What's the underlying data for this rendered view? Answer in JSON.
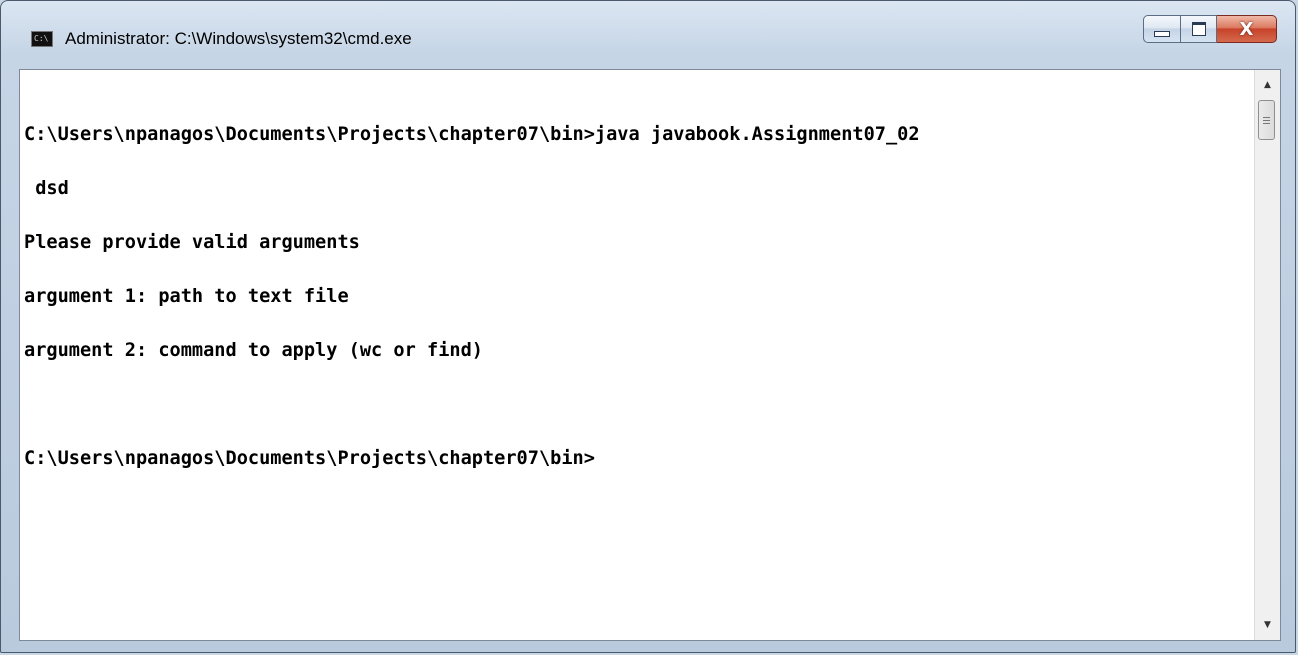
{
  "window": {
    "title": "Administrator: C:\\Windows\\system32\\cmd.exe",
    "icon": "console-app-icon",
    "icon_text": "C:\\",
    "controls": {
      "minimize": "minimize-icon",
      "maximize": "maximize-icon",
      "close": "close-icon",
      "close_glyph": "X"
    }
  },
  "console": {
    "lines": [
      "C:\\Users\\npanagos\\Documents\\Projects\\chapter07\\bin>java javabook.Assignment07_02",
      " dsd",
      "Please provide valid arguments",
      "argument 1: path to text file",
      "argument 2: command to apply (wc or find)",
      "",
      "C:\\Users\\npanagos\\Documents\\Projects\\chapter07\\bin>"
    ]
  },
  "scrollbar": {
    "up_icon": "scroll-up-arrow-icon",
    "down_icon": "scroll-down-arrow-icon",
    "up_glyph": "▲",
    "down_glyph": "▼"
  },
  "colors": {
    "console_background": "#ffffff",
    "console_text": "#000000",
    "close_button": "#c7432a"
  }
}
